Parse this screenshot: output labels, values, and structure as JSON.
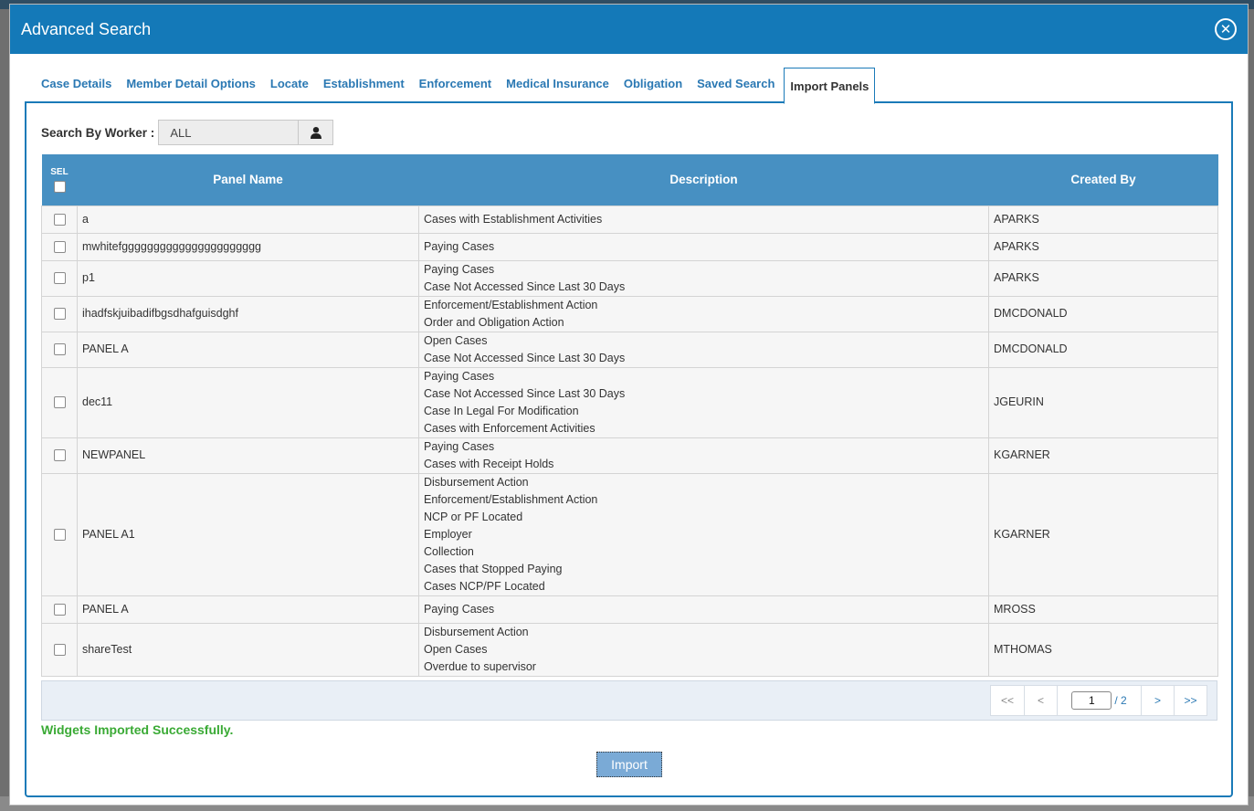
{
  "modal": {
    "title": "Advanced Search"
  },
  "tabs": [
    {
      "label": "Case Details"
    },
    {
      "label": "Member Detail Options"
    },
    {
      "label": "Locate"
    },
    {
      "label": "Establishment"
    },
    {
      "label": "Enforcement"
    },
    {
      "label": "Medical Insurance"
    },
    {
      "label": "Obligation"
    },
    {
      "label": "Saved Search"
    },
    {
      "label": "Import Panels"
    }
  ],
  "worker": {
    "label": "Search By Worker :",
    "value": "ALL"
  },
  "table": {
    "headers": {
      "sel": "SEL",
      "panel_name": "Panel Name",
      "description": "Description",
      "created_by": "Created By"
    },
    "rows": [
      {
        "name": "a",
        "desc": [
          "Cases with Establishment Activities"
        ],
        "by": "APARKS"
      },
      {
        "name": "mwhitefgggggggggggggggggggggg",
        "desc": [
          "Paying Cases"
        ],
        "by": "APARKS"
      },
      {
        "name": "p1",
        "desc": [
          "Paying Cases",
          "Case Not Accessed Since Last 30 Days"
        ],
        "by": "APARKS"
      },
      {
        "name": "ihadfskjuibadifbgsdhafguisdghf",
        "desc": [
          "Enforcement/Establishment Action",
          "Order and Obligation Action"
        ],
        "by": "DMCDONALD"
      },
      {
        "name": "PANEL A",
        "desc": [
          "Open Cases",
          "Case Not Accessed Since Last 30 Days"
        ],
        "by": "DMCDONALD"
      },
      {
        "name": "dec11",
        "desc": [
          "Paying Cases",
          "Case Not Accessed Since Last 30 Days",
          "Case In Legal For Modification",
          "Cases with Enforcement Activities"
        ],
        "by": "JGEURIN"
      },
      {
        "name": "NEWPANEL",
        "desc": [
          "Paying Cases",
          "Cases with Receipt Holds"
        ],
        "by": "KGARNER"
      },
      {
        "name": "PANEL A1",
        "desc": [
          "Disbursement Action",
          "Enforcement/Establishment Action",
          "NCP or PF Located",
          "Employer",
          "Collection",
          "Cases that Stopped Paying",
          "Cases NCP/PF Located"
        ],
        "by": "KGARNER"
      },
      {
        "name": "PANEL A",
        "desc": [
          "Paying Cases"
        ],
        "by": "MROSS"
      },
      {
        "name": "shareTest",
        "desc": [
          "Disbursement Action",
          "Open Cases",
          "Overdue to supervisor"
        ],
        "by": "MTHOMAS"
      }
    ]
  },
  "pager": {
    "first": "<<",
    "prev": "<",
    "current_page": "1",
    "total": "/ 2",
    "next": ">",
    "last": ">>"
  },
  "status_message": "Widgets Imported Successfully.",
  "import_button": "Import",
  "colors": {
    "header_blue": "#1479b8",
    "table_header": "#4790c2",
    "link_blue": "#2a78b3",
    "success_green": "#3aaa35"
  }
}
